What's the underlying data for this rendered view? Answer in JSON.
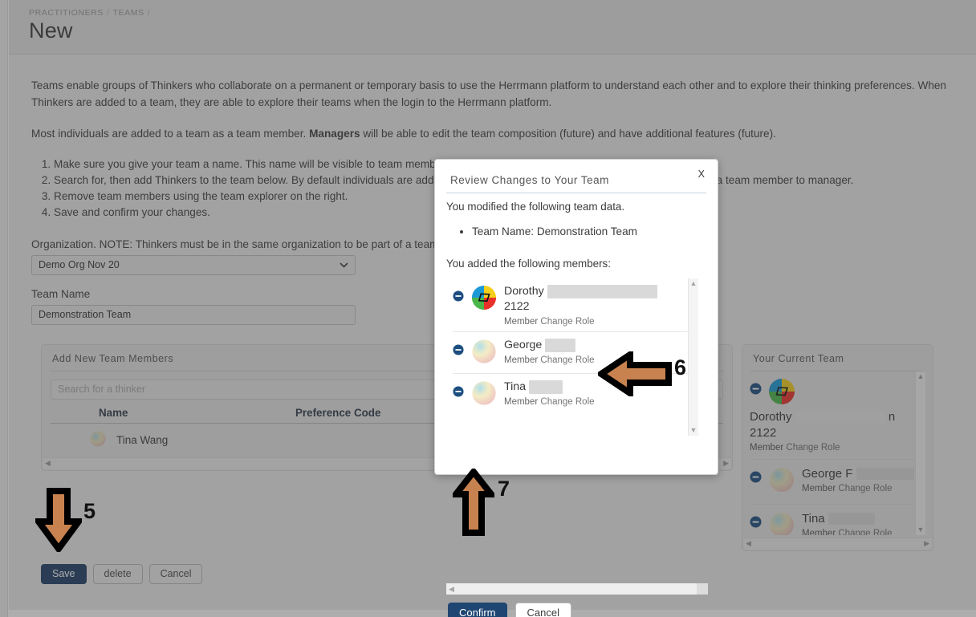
{
  "header": {
    "breadcrumb": [
      "PRACTITIONERS",
      "TEAMS"
    ],
    "title": "New"
  },
  "intro": {
    "paragraph1": "Teams enable groups of Thinkers who collaborate on a permanent or temporary basis to use the Herrmann platform to understand each other and to explore their thinking preferences. When Thinkers are added to a team, they are able to explore their teams when the login to the Herrmann platform.",
    "paragraph2_pre": "Most individuals are added to a team as a team member. ",
    "paragraph2_bold": "Managers",
    "paragraph2_post": " will be able to edit the team composition (future) and have additional features (future).",
    "steps": [
      "Make sure you give your team a name. This name will be visible to team members.",
      "Search for, then add Thinkers to the team below. By default individuals are added as a team member. Use the change role link to change a team member to manager.",
      "Remove team members using the team explorer on the right.",
      "Save and confirm your changes."
    ]
  },
  "form": {
    "org_label": "Organization. NOTE: Thinkers must be in the same organization to be part of a team.",
    "org_value": "Demo Org Nov 20",
    "team_name_label": "Team Name",
    "team_name_value": "Demonstration Team"
  },
  "add_panel": {
    "title": "Add New Team Members",
    "search_placeholder": "Search for a thinker",
    "search_value": "",
    "columns": [
      "Name",
      "Preference Code"
    ],
    "rows": [
      {
        "name": "Tina Wang",
        "preference_code": ""
      }
    ]
  },
  "current_team_panel": {
    "title": "Your Current Team",
    "members": [
      {
        "first": "Dorothy",
        "redacted": true,
        "line2": "2122",
        "role": "Member",
        "change_role": "Change Role"
      },
      {
        "first": "George F",
        "redacted": true,
        "line2": "",
        "role": "Member",
        "change_role": "Change Role"
      },
      {
        "first": "Tina",
        "redacted": true,
        "line2": "",
        "role": "Member",
        "change_role": "Change Role"
      }
    ]
  },
  "footer_actions": {
    "save": "Save",
    "delete": "delete",
    "cancel": "Cancel"
  },
  "modal": {
    "title": "Review Changes to Your Team",
    "close": "X",
    "intro": "You modified the following team data.",
    "bullets": [
      "Team Name: Demonstration Team"
    ],
    "members_heading": "You added the following members:",
    "members": [
      {
        "first": "Dorothy",
        "line2": "2122",
        "role": "Member",
        "change_role": "Change Role"
      },
      {
        "first": "George",
        "line2": "",
        "role": "Member",
        "change_role": "Change Role"
      },
      {
        "first": "Tina",
        "line2": "",
        "role": "Member",
        "change_role": "Change Role"
      }
    ],
    "confirm": "Confirm",
    "cancel": "Cancel"
  },
  "annotations": {
    "step5": "5",
    "step6": "6",
    "step7": "7"
  },
  "colors": {
    "primary": "#1f4672",
    "arrow_fill": "#c8824f",
    "arrow_stroke": "#000000",
    "quad_blue": "#1b9ad6",
    "quad_yellow": "#f5cf1e",
    "quad_green": "#4bb749",
    "quad_red": "#e8312a"
  }
}
